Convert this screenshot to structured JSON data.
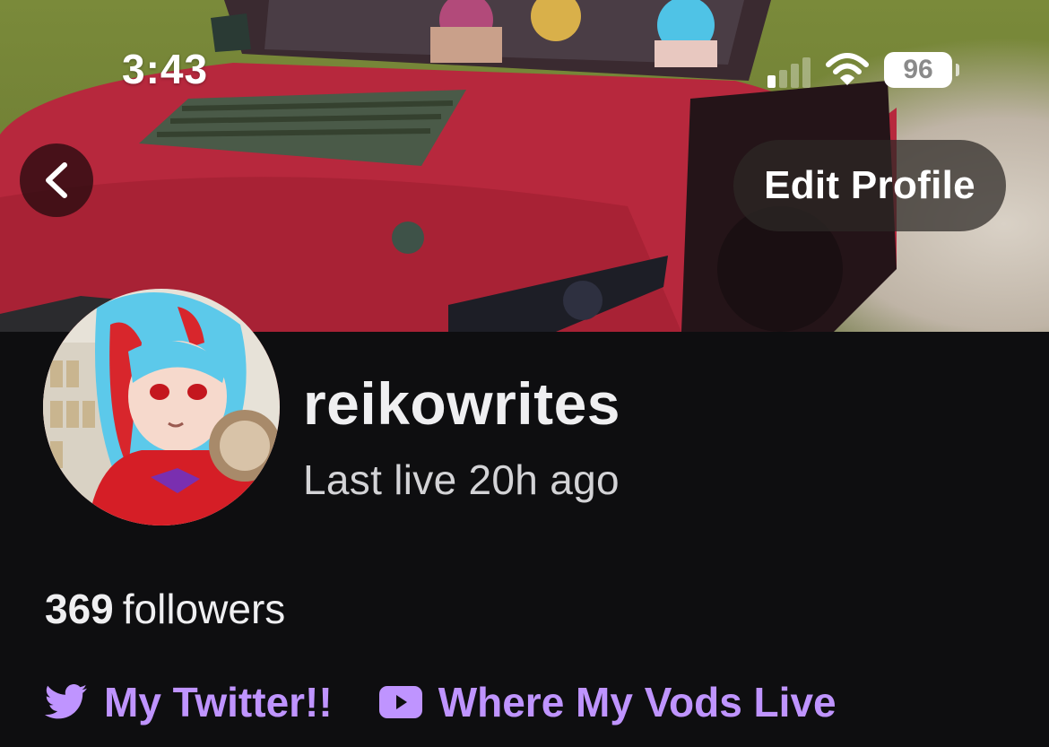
{
  "status_bar": {
    "time": "3:43",
    "battery_level": "96",
    "icons": [
      "cellular-signal-icon",
      "wifi-icon",
      "battery-icon"
    ]
  },
  "nav": {
    "back_icon": "chevron-left-icon",
    "edit_profile_label": "Edit Profile"
  },
  "profile": {
    "username": "reikowrites",
    "last_live": "Last live 20h ago",
    "followers_count": "369",
    "followers_label": "followers"
  },
  "links": [
    {
      "label": "My Twitter!!",
      "icon": "twitter-icon"
    },
    {
      "label": "Where My Vods Live",
      "icon": "youtube-icon"
    }
  ],
  "colors": {
    "background": "#0e0e10",
    "link_accent": "#bf94ff",
    "text_primary": "#efeff1",
    "banner_car": "#b7283d"
  }
}
